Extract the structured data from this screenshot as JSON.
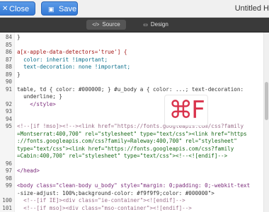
{
  "toolbar": {
    "close_label": "Close",
    "save_label": "Save",
    "doc_title": "Untitled H"
  },
  "modebar": {
    "tabs": [
      {
        "label": "Source",
        "active": true
      },
      {
        "label": "Design",
        "active": false
      }
    ]
  },
  "editor": {
    "lines": [
      {
        "n": "84",
        "text": "}"
      },
      {
        "n": "85",
        "text": ""
      },
      {
        "n": "86",
        "text": "a[x-apple-data-detectors='true'] {"
      },
      {
        "n": "87",
        "text": "  color: inherit !important;"
      },
      {
        "n": "88",
        "text": "  text-decoration: none !important;"
      },
      {
        "n": "89",
        "text": "}"
      },
      {
        "n": "90",
        "text": ""
      },
      {
        "n": "91",
        "text": "table, td { color: #000000; } #u_body a { color: ...; text-decoration:"
      },
      {
        "n": "",
        "text": "  underline; }"
      },
      {
        "n": "92",
        "text": "    </style>"
      },
      {
        "n": "93",
        "text": ""
      },
      {
        "n": "94",
        "text": ""
      },
      {
        "n": "95",
        "text": "<!--[if !mso]><!--><link href=\"https://fonts.googleapis.com/css?family"
      },
      {
        "n": "",
        "text": "=Montserrat:400,700\" rel=\"stylesheet\" type=\"text/css\"><link href=\"https"
      },
      {
        "n": "",
        "text": "://fonts.googleapis.com/css?family=Raleway:400,700\" rel=\"stylesheet\""
      },
      {
        "n": "",
        "text": "type=\"text/css\"><link href=\"https://fonts.googleapis.com/css?family"
      },
      {
        "n": "",
        "text": "=Cabin:400,700\" rel=\"stylesheet\" type=\"text/css\"><!--<![endif]-->"
      },
      {
        "n": "96",
        "text": ""
      },
      {
        "n": "97",
        "text": "</head>"
      },
      {
        "n": "98",
        "text": ""
      },
      {
        "n": "99",
        "text": "<body class=\"clean-body u_body\" style=\"margin: 0;padding: 0;-webkit-text"
      },
      {
        "n": "",
        "text": "-size-adjust: 100%;background-color: #f9f9f9;color: #000000\">"
      },
      {
        "n": "100",
        "text": "  <!--[if IE]><div class=\"ie-container\"><![endif]-->"
      },
      {
        "n": "101",
        "text": "  <!--[if mso]><div class=\"mso-container\"><![endif]-->"
      }
    ]
  },
  "search_overlay": {
    "glyph": "⌘F"
  },
  "colors": {
    "accent": "#3479d6",
    "search_glyph": "#d9334c"
  },
  "icons": {
    "close": "close-icon",
    "save": "save-icon",
    "source": "source-code-icon",
    "design": "design-icon"
  }
}
